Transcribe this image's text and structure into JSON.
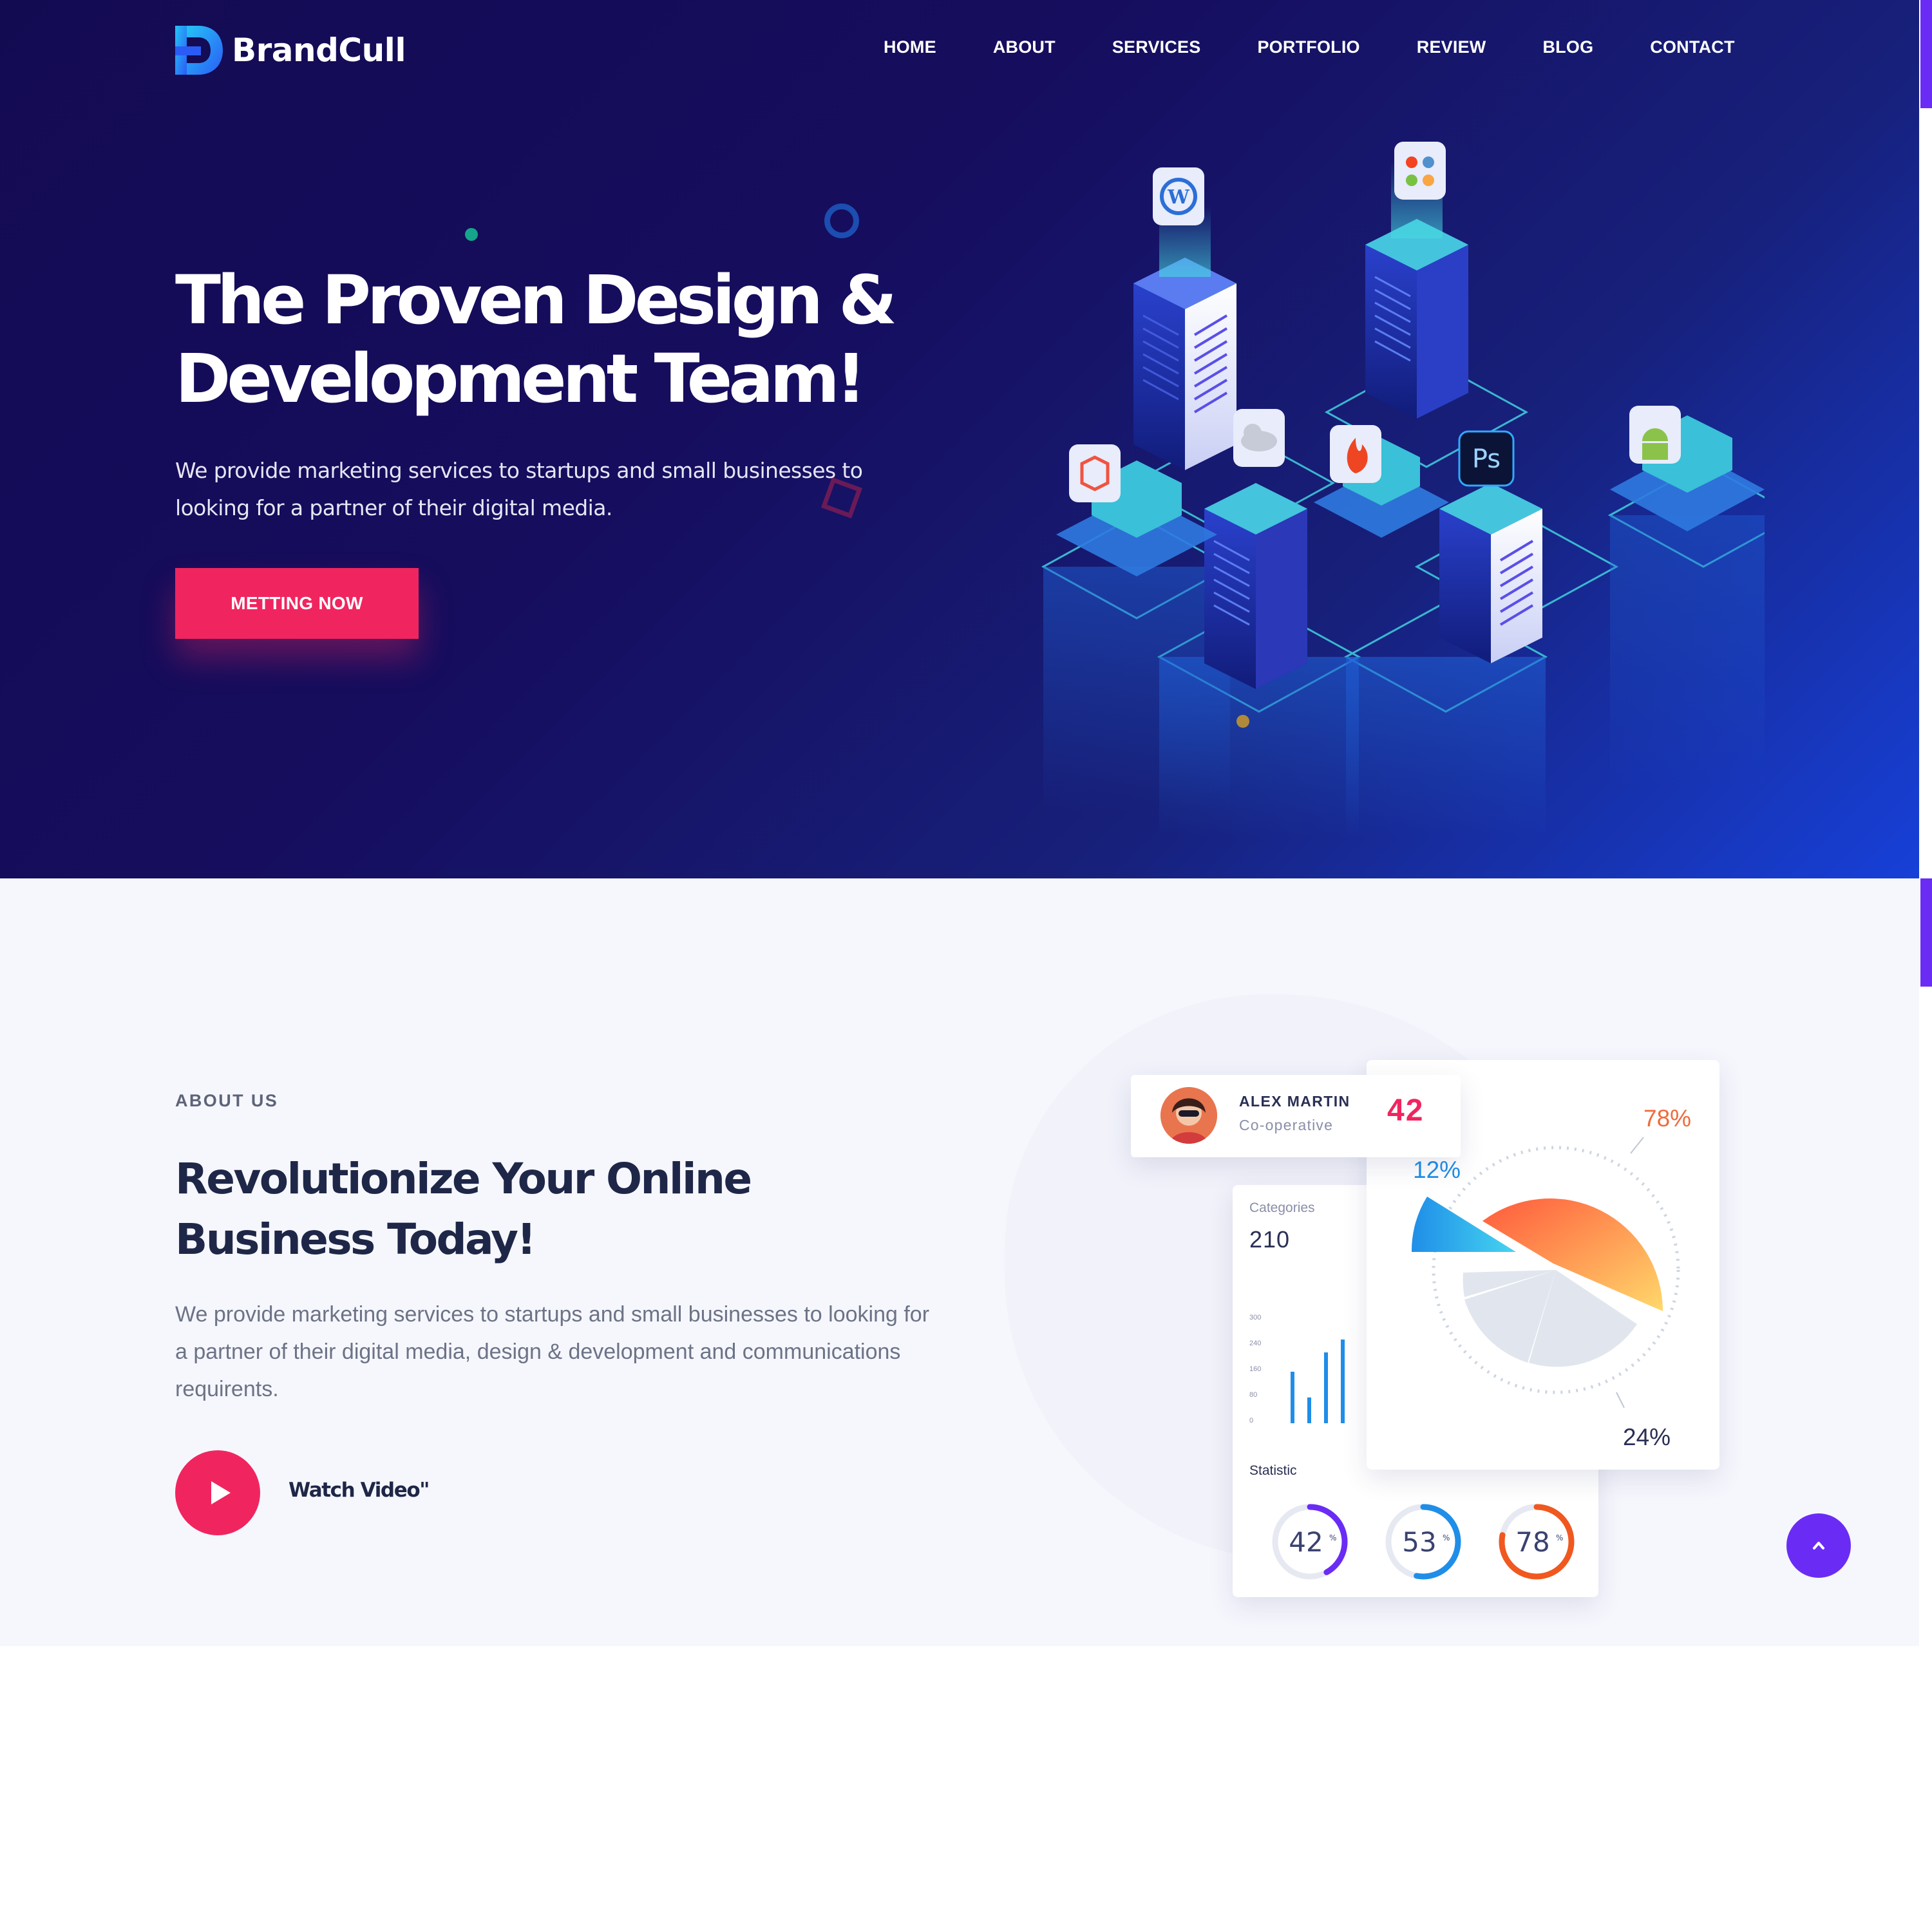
{
  "brand": {
    "name": "BrandCull"
  },
  "nav": {
    "items": [
      "HOME",
      "ABOUT",
      "SERVICES",
      "PORTFOLIO",
      "REVIEW",
      "BLOG",
      "CONTACT"
    ]
  },
  "hero": {
    "title_line1": "The Proven Design &",
    "title_line2": "Development Team!",
    "subtitle_line1": "We provide marketing services to startups and small businesses to",
    "subtitle_line2": "looking for a partner of their digital media.",
    "button_label": "METTING NOW",
    "icons": [
      "wordpress-icon",
      "joomla-icon",
      "cloud-icon",
      "laravel-icon",
      "codeigniter-icon",
      "photoshop-icon",
      "android-icon"
    ],
    "ps_label": "Ps"
  },
  "about": {
    "eyebrow": "ABOUT US",
    "title_line1": "Revolutionize Your Online",
    "title_line2": "Business Today!",
    "text_line1": "We provide marketing services to startups and small businesses to looking for",
    "text_line2": "a partner of their digital media, design & development and communications",
    "text_line3": "requirents.",
    "watch_label": "Watch Video\""
  },
  "dashboard": {
    "user": {
      "name": "ALEX MARTIN",
      "role": "Co-operative",
      "score": "42"
    },
    "categories": {
      "label": "Categories",
      "value": "210"
    },
    "bar_ticks": [
      "300",
      "240",
      "160",
      "80",
      "0"
    ],
    "statistic_label": "Statistic",
    "rings": [
      {
        "value": "42",
        "suffix": "%",
        "percent": 42,
        "color": "#6a2cf5"
      },
      {
        "value": "53",
        "suffix": "%",
        "percent": 53,
        "color": "#1f8ee8"
      },
      {
        "value": "78",
        "suffix": "%",
        "percent": 78,
        "color": "#f0581f"
      }
    ],
    "pie": {
      "labels": {
        "a": "78%",
        "b": "12%",
        "c": "24%"
      },
      "colors": {
        "orange": "#ff7a45",
        "blue": "#2b8cff",
        "grey": "#e1e6ee"
      }
    }
  },
  "colors": {
    "accent": "#f0255f",
    "brand": "#6a2cf5",
    "hero_bg": "#130b52"
  }
}
